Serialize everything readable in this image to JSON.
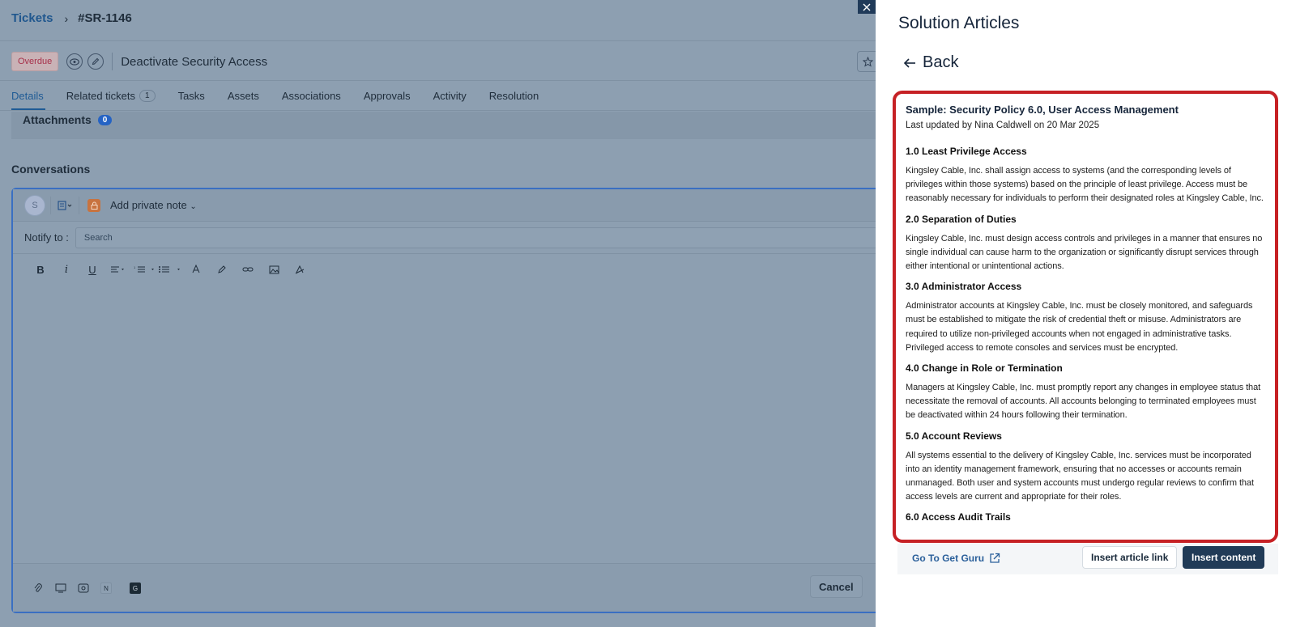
{
  "breadcrumb": {
    "root": "Tickets",
    "ticket_id": "#SR-1146"
  },
  "ticket": {
    "status": "Overdue",
    "title": "Deactivate Security Access"
  },
  "tabs": [
    {
      "label": "Details",
      "count": ""
    },
    {
      "label": "Related tickets",
      "count": "1"
    },
    {
      "label": "Tasks",
      "count": ""
    },
    {
      "label": "Assets",
      "count": ""
    },
    {
      "label": "Associations",
      "count": ""
    },
    {
      "label": "Approvals",
      "count": ""
    },
    {
      "label": "Activity",
      "count": ""
    },
    {
      "label": "Resolution",
      "count": ""
    }
  ],
  "attachments": {
    "label": "Attachments",
    "count": "0"
  },
  "conversations": {
    "label": "Conversations",
    "avatar_initial": "S",
    "note_type": "Add private note",
    "notify_label": "Notify to :",
    "search_placeholder": "Search",
    "cancel_label": "Cancel",
    "bottom_badges": [
      "N",
      "G"
    ]
  },
  "panel": {
    "title": "Solution Articles",
    "back_label": "Back",
    "article": {
      "title": "Sample: Security Policy 6.0, User Access Management",
      "updated": "Last updated by Nina Caldwell on 20 Mar 2025",
      "sections": [
        {
          "heading": "1.0 Least Privilege Access",
          "body": "Kingsley Cable, Inc. shall assign access to systems (and the corresponding levels of privileges within those systems) based on the principle of least privilege. Access must be reasonably necessary for individuals to perform their designated roles at Kingsley Cable, Inc."
        },
        {
          "heading": "2.0 Separation of Duties",
          "body": "Kingsley Cable, Inc. must design access controls and privileges in a manner that ensures no single individual can cause harm to the organization or significantly disrupt services through either intentional or unintentional actions."
        },
        {
          "heading": "3.0 Administrator Access",
          "body": "Administrator accounts at Kingsley Cable, Inc. must be closely monitored, and safeguards must be established to mitigate the risk of credential theft or misuse. Administrators are required to utilize non-privileged accounts when not engaged in administrative tasks. Privileged access to remote consoles and services must be encrypted."
        },
        {
          "heading": "4.0 Change in Role or Termination",
          "body": "Managers at Kingsley Cable, Inc. must promptly report any changes in employee status that necessitate the removal of accounts. All accounts belonging to terminated employees must be deactivated within 24 hours following their termination."
        },
        {
          "heading": "5.0 Account Reviews",
          "body": "All systems essential to the delivery of Kingsley Cable, Inc. services must be incorporated into an identity management framework, ensuring that no accesses or accounts remain unmanaged. Both user and system accounts must undergo regular reviews to confirm that access levels are current and appropriate for their roles."
        },
        {
          "heading": "6.0 Access Audit Trails",
          "body": ""
        }
      ]
    },
    "footer": {
      "guru_link": "Go To Get Guru",
      "insert_link": "Insert article link",
      "insert_content": "Insert content"
    }
  },
  "colors": {
    "accent": "#213b57",
    "highlight_border": "#c62125",
    "link": "#2a5f9a",
    "overlay": "#8d9fb1"
  }
}
